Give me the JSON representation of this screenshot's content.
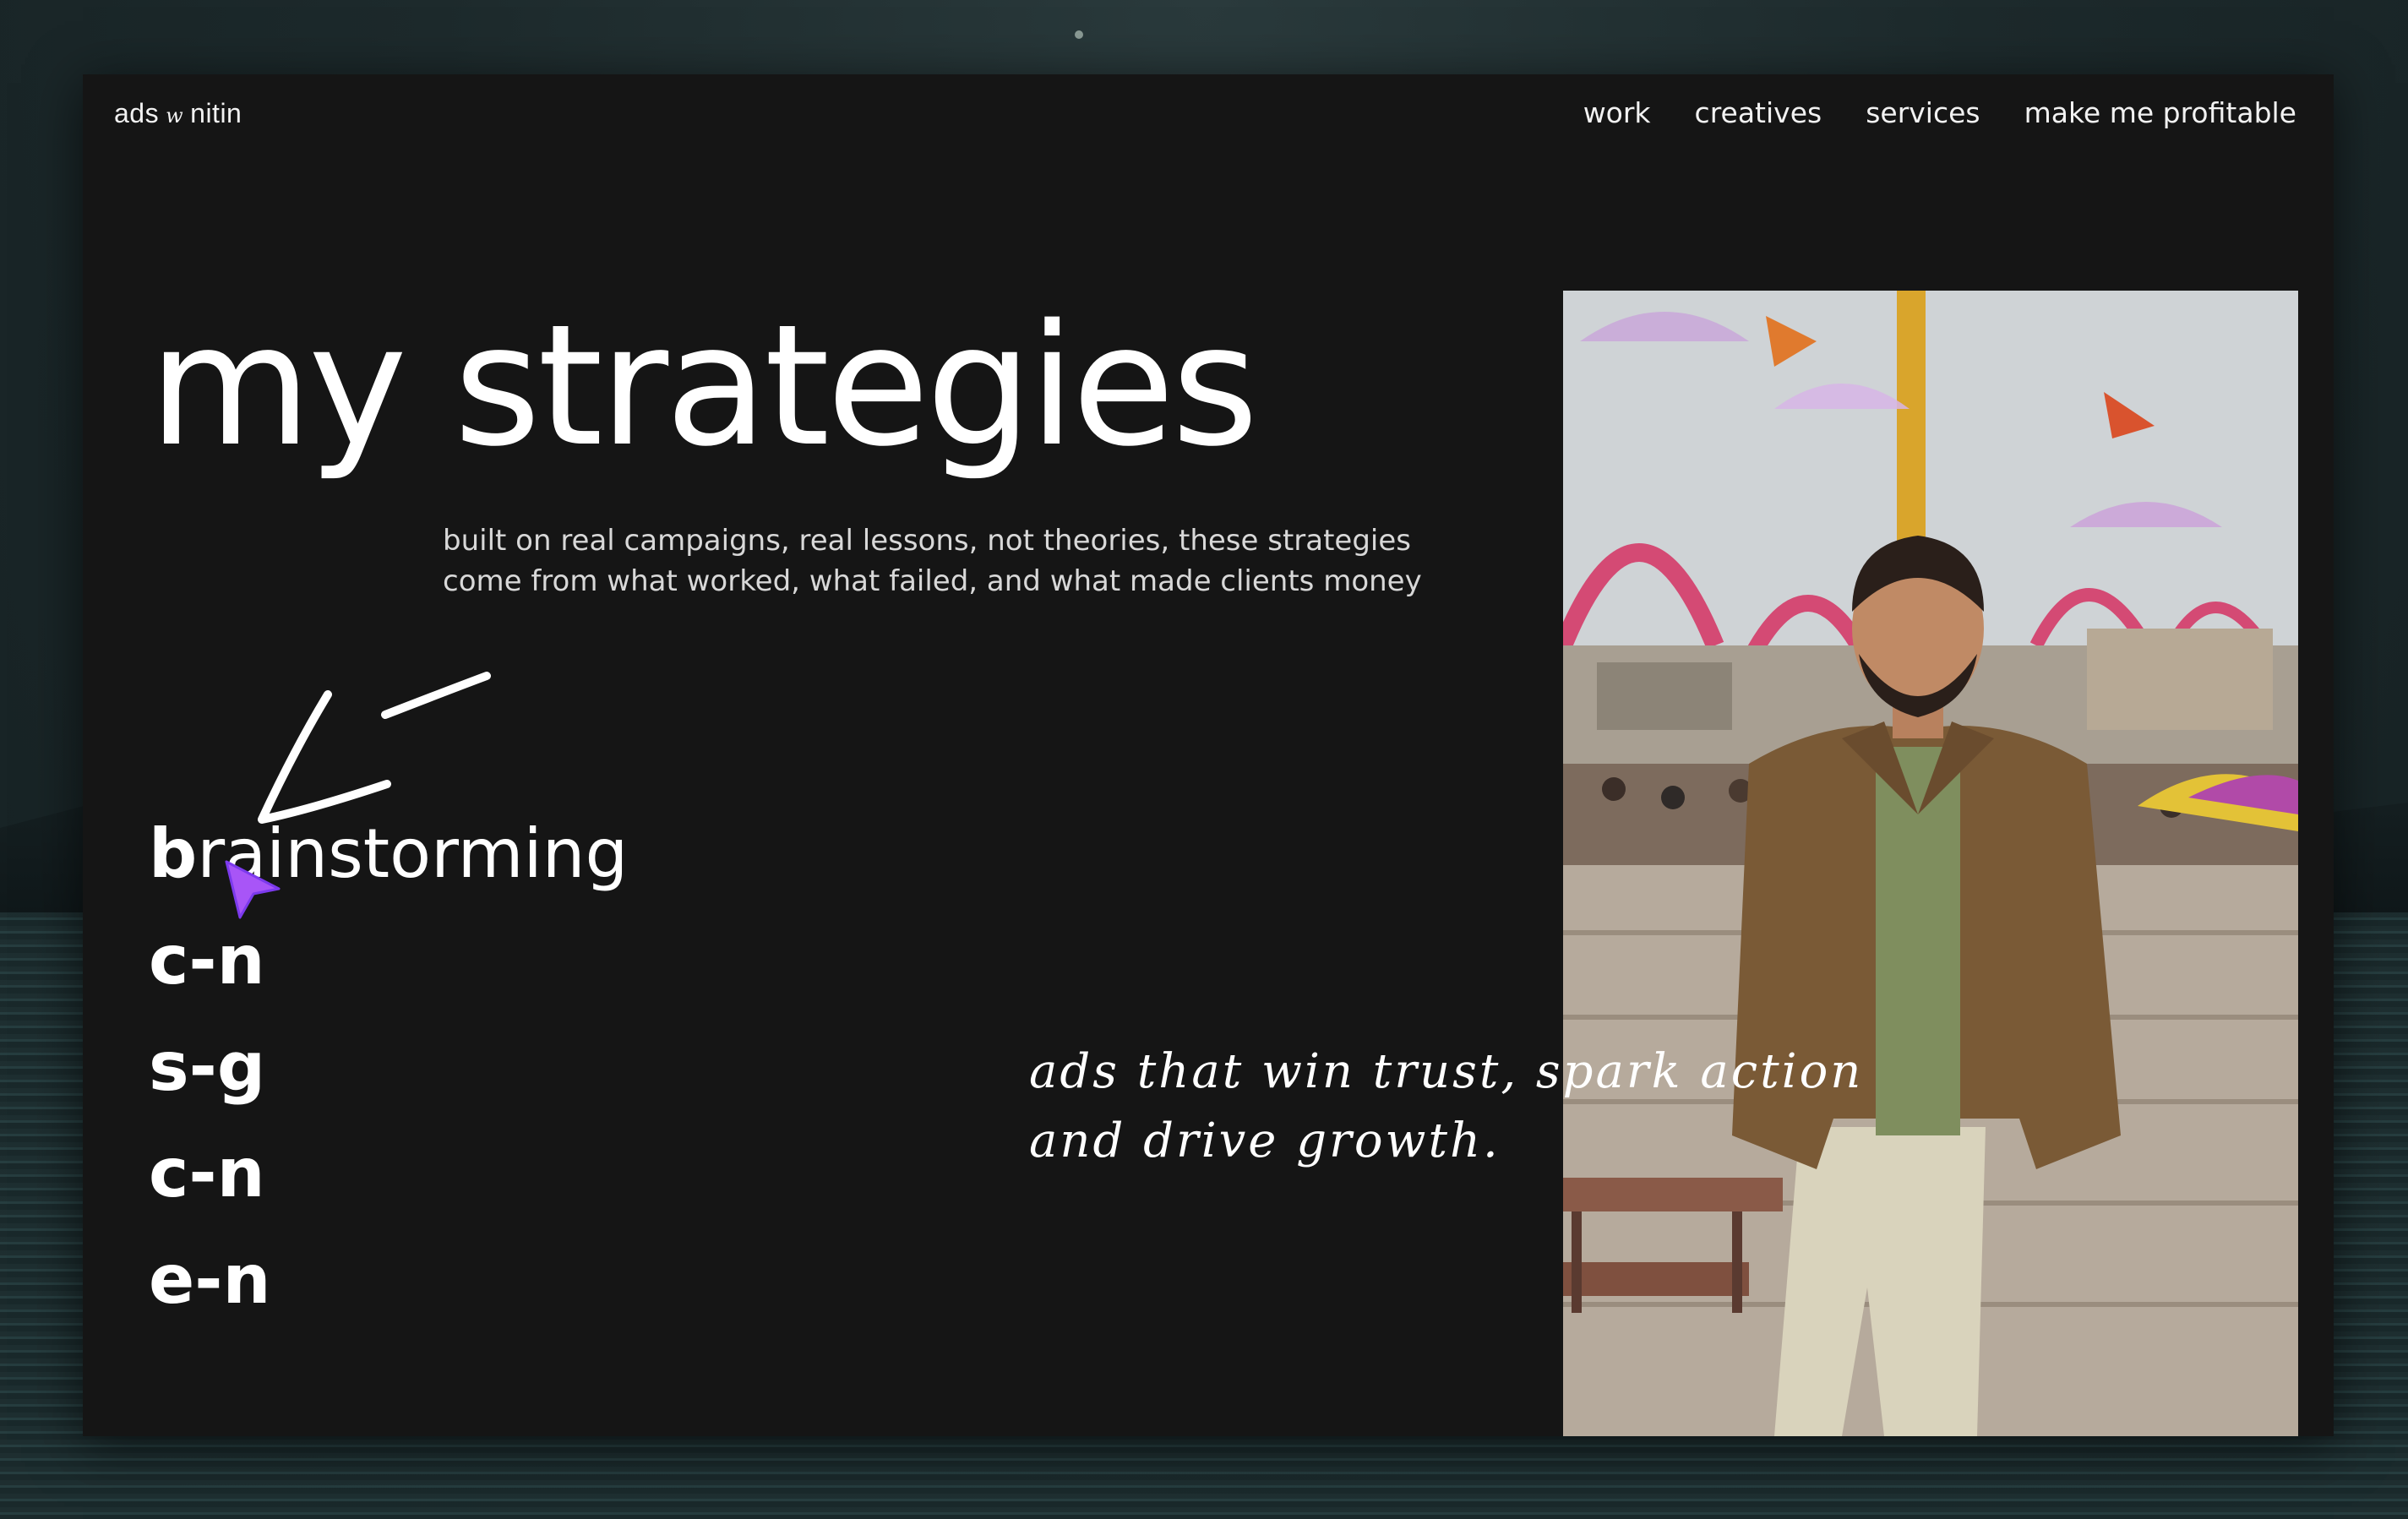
{
  "brand": {
    "name_left": "ads",
    "name_mid": "w",
    "name_right": "nitin"
  },
  "nav": {
    "items": [
      {
        "label": "work"
      },
      {
        "label": "creatives"
      },
      {
        "label": "services"
      },
      {
        "label": "make me profitable"
      }
    ]
  },
  "hero": {
    "title": "my strategies",
    "subtitle_line1": "built on real campaigns, real lessons, not theories, these strategies",
    "subtitle_line2": "come from what worked, what failed, and what made clients money"
  },
  "strategies": {
    "items": [
      {
        "first": "b",
        "rest": "rainstorming",
        "active": true
      },
      {
        "label": "c-n"
      },
      {
        "label": "s-g"
      },
      {
        "label": "c-n"
      },
      {
        "label": "e-n"
      }
    ]
  },
  "quote": {
    "line1": "ads that win trust, spark action",
    "line2": "and drive growth."
  },
  "colors": {
    "page_bg": "#151515",
    "text": "#ffffff",
    "cursor": "#a855f7"
  },
  "icons": {
    "cursor": "pointer-cursor-icon",
    "arrow": "hand-drawn-arrow-icon"
  }
}
